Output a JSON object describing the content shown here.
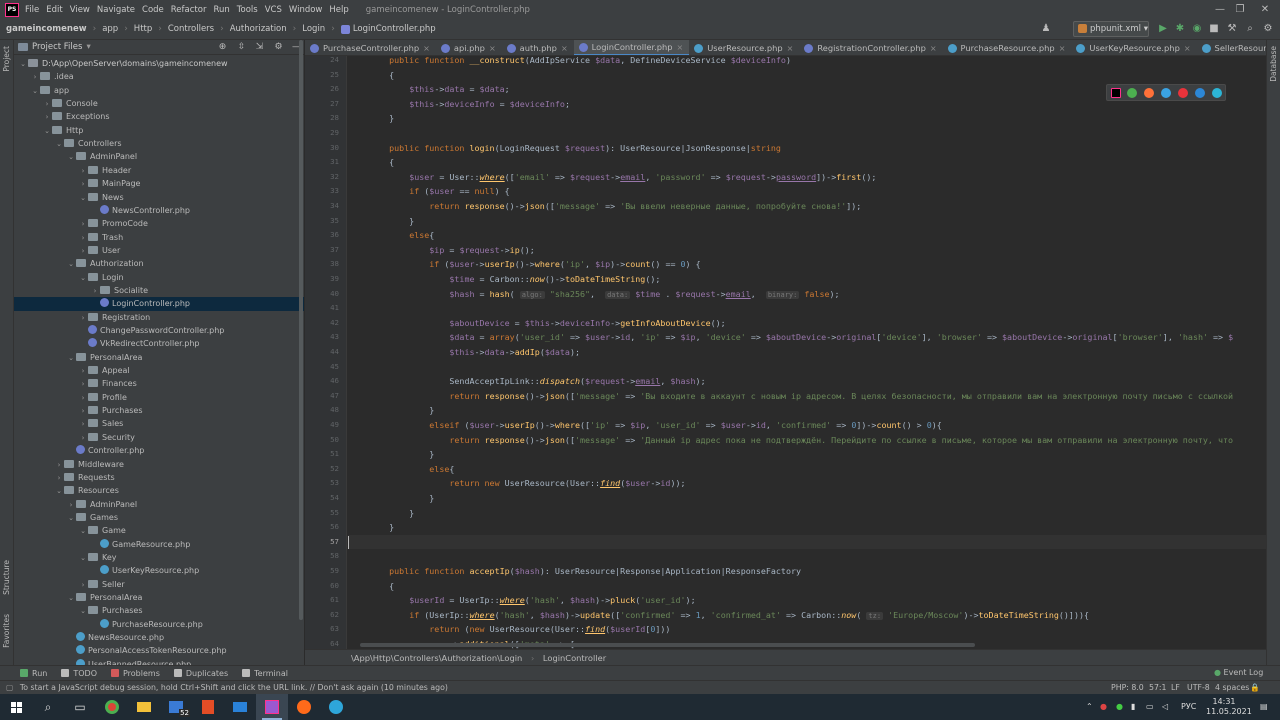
{
  "window": {
    "menu": [
      "File",
      "Edit",
      "View",
      "Navigate",
      "Code",
      "Refactor",
      "Run",
      "Tools",
      "VCS",
      "Window",
      "Help"
    ],
    "title": "gameincomenew - LoginController.php",
    "logo": "PS"
  },
  "navbar": {
    "breadcrumbs": [
      "gameincomenew",
      "app",
      "Http",
      "Controllers",
      "Authorization",
      "Login",
      "LoginController.php"
    ],
    "run_config": "phpunit.xml"
  },
  "side_strips": {
    "left_top": "Project",
    "left_mid": "Structure",
    "left_bottom": "Favorites",
    "right": "Database"
  },
  "project": {
    "title": "Project Files",
    "tree": [
      {
        "label": "D:\\App\\OpenServer\\domains\\gameincomenew",
        "depth": 0,
        "open": true,
        "type": "root"
      },
      {
        "label": ".idea",
        "depth": 1,
        "open": false,
        "type": "folder"
      },
      {
        "label": "app",
        "depth": 1,
        "open": true,
        "type": "folder"
      },
      {
        "label": "Console",
        "depth": 2,
        "open": false,
        "type": "folder"
      },
      {
        "label": "Exceptions",
        "depth": 2,
        "open": false,
        "type": "folder"
      },
      {
        "label": "Http",
        "depth": 2,
        "open": true,
        "type": "folder"
      },
      {
        "label": "Controllers",
        "depth": 3,
        "open": true,
        "type": "folder"
      },
      {
        "label": "AdminPanel",
        "depth": 4,
        "open": true,
        "type": "folder"
      },
      {
        "label": "Header",
        "depth": 5,
        "open": false,
        "type": "folder"
      },
      {
        "label": "MainPage",
        "depth": 5,
        "open": false,
        "type": "folder"
      },
      {
        "label": "News",
        "depth": 5,
        "open": true,
        "type": "folder"
      },
      {
        "label": "NewsController.php",
        "depth": 6,
        "type": "file"
      },
      {
        "label": "PromoCode",
        "depth": 5,
        "open": false,
        "type": "folder"
      },
      {
        "label": "Trash",
        "depth": 5,
        "open": false,
        "type": "folder"
      },
      {
        "label": "User",
        "depth": 5,
        "open": false,
        "type": "folder"
      },
      {
        "label": "Authorization",
        "depth": 4,
        "open": true,
        "type": "folder"
      },
      {
        "label": "Login",
        "depth": 5,
        "open": true,
        "type": "folder"
      },
      {
        "label": "Socialite",
        "depth": 6,
        "open": false,
        "type": "folder"
      },
      {
        "label": "LoginController.php",
        "depth": 6,
        "type": "file",
        "selected": true
      },
      {
        "label": "Registration",
        "depth": 5,
        "open": false,
        "type": "folder"
      },
      {
        "label": "ChangePasswordController.php",
        "depth": 5,
        "type": "file"
      },
      {
        "label": "VkRedirectController.php",
        "depth": 5,
        "type": "file"
      },
      {
        "label": "PersonalArea",
        "depth": 4,
        "open": true,
        "type": "folder"
      },
      {
        "label": "Appeal",
        "depth": 5,
        "open": false,
        "type": "folder"
      },
      {
        "label": "Finances",
        "depth": 5,
        "open": false,
        "type": "folder"
      },
      {
        "label": "Profile",
        "depth": 5,
        "open": false,
        "type": "folder"
      },
      {
        "label": "Purchases",
        "depth": 5,
        "open": false,
        "type": "folder"
      },
      {
        "label": "Sales",
        "depth": 5,
        "open": false,
        "type": "folder"
      },
      {
        "label": "Security",
        "depth": 5,
        "open": false,
        "type": "folder"
      },
      {
        "label": "Controller.php",
        "depth": 4,
        "type": "file"
      },
      {
        "label": "Middleware",
        "depth": 3,
        "open": false,
        "type": "folder"
      },
      {
        "label": "Requests",
        "depth": 3,
        "open": false,
        "type": "folder"
      },
      {
        "label": "Resources",
        "depth": 3,
        "open": true,
        "type": "folder"
      },
      {
        "label": "AdminPanel",
        "depth": 4,
        "open": false,
        "type": "folder"
      },
      {
        "label": "Games",
        "depth": 4,
        "open": true,
        "type": "folder"
      },
      {
        "label": "Game",
        "depth": 5,
        "open": true,
        "type": "folder"
      },
      {
        "label": "GameResource.php",
        "depth": 6,
        "type": "res"
      },
      {
        "label": "Key",
        "depth": 5,
        "open": true,
        "type": "folder"
      },
      {
        "label": "UserKeyResource.php",
        "depth": 6,
        "type": "res"
      },
      {
        "label": "Seller",
        "depth": 5,
        "open": false,
        "type": "folder"
      },
      {
        "label": "PersonalArea",
        "depth": 4,
        "open": true,
        "type": "folder"
      },
      {
        "label": "Purchases",
        "depth": 5,
        "open": true,
        "type": "folder"
      },
      {
        "label": "PurchaseResource.php",
        "depth": 6,
        "type": "res"
      },
      {
        "label": "NewsResource.php",
        "depth": 4,
        "type": "res"
      },
      {
        "label": "PersonalAccessTokenResource.php",
        "depth": 4,
        "type": "res"
      },
      {
        "label": "UserBannedResource.php",
        "depth": 4,
        "type": "res"
      }
    ]
  },
  "tabs": [
    {
      "label": "PurchaseController.php",
      "type": "php"
    },
    {
      "label": "api.php",
      "type": "php"
    },
    {
      "label": "auth.php",
      "type": "php"
    },
    {
      "label": "LoginController.php",
      "type": "php",
      "active": true
    },
    {
      "label": "UserResource.php",
      "type": "res"
    },
    {
      "label": "RegistrationController.php",
      "type": "php"
    },
    {
      "label": "PurchaseResource.php",
      "type": "res"
    },
    {
      "label": "UserKeyResource.php",
      "type": "res"
    },
    {
      "label": "SellerResource.php",
      "type": "res"
    }
  ],
  "editor": {
    "warning_count": "9",
    "current_line": 57,
    "lines": [
      {
        "n": 24,
        "html": "    <span class=\"kw\">public function </span><span class=\"fn\">__construct</span>(AddIpService <span class=\"vr\">$data</span>, DefineDeviceService <span class=\"vr\">$deviceInfo</span>)"
      },
      {
        "n": 25,
        "html": "    {"
      },
      {
        "n": 26,
        "html": "        <span class=\"vr\">$this</span>-><span class=\"vr\">data</span> = <span class=\"vr\">$data</span>;"
      },
      {
        "n": 27,
        "html": "        <span class=\"vr\">$this</span>-><span class=\"vr\">deviceInfo</span> = <span class=\"vr\">$deviceInfo</span>;"
      },
      {
        "n": 28,
        "html": "    }"
      },
      {
        "n": 29,
        "html": ""
      },
      {
        "n": 30,
        "html": "    <span class=\"kw\">public function </span><span class=\"fn\">login</span>(LoginRequest <span class=\"vr\">$request</span>): UserResource|JsonResponse|<span class=\"kw\">string</span>"
      },
      {
        "n": 31,
        "html": "    {"
      },
      {
        "n": 32,
        "html": "        <span class=\"vr\">$user</span> = User::<span class=\"it ul\">where</span>([<span class=\"st\">'email'</span> => <span class=\"vr\">$request</span>-><span class=\"vr ul\">email</span>, <span class=\"st\">'password'</span> => <span class=\"vr\">$request</span>-><span class=\"vr ul\">password</span>])-><span class=\"me\">first</span>();"
      },
      {
        "n": 33,
        "html": "        <span class=\"kw\">if </span>(<span class=\"vr\">$user</span> == <span class=\"kw\">null</span>) {"
      },
      {
        "n": 34,
        "html": "            <span class=\"kw\">return </span><span class=\"me\">response</span>()-><span class=\"me\">json</span>([<span class=\"st\">'message'</span> => <span class=\"st\">'Вы ввели неверные данные, попробуйте снова!'</span>]);"
      },
      {
        "n": 35,
        "html": "        }"
      },
      {
        "n": 36,
        "html": "        <span class=\"kw\">else</span>{"
      },
      {
        "n": 37,
        "html": "            <span class=\"vr\">$ip</span> = <span class=\"vr\">$request</span>-><span class=\"me\">ip</span>();"
      },
      {
        "n": 38,
        "html": "            <span class=\"kw\">if </span>(<span class=\"vr\">$user</span>-><span class=\"me\">userIp</span>()-><span class=\"me\">where</span>(<span class=\"st\">'ip'</span>, <span class=\"vr\">$ip</span>)-><span class=\"me\">count</span>() == <span class=\"nm\">0</span>) {"
      },
      {
        "n": 39,
        "html": "                <span class=\"vr\">$time</span> = Carbon::<span class=\"it\">now</span>()-><span class=\"me\">toDateTimeString</span>();"
      },
      {
        "n": 40,
        "html": "                <span class=\"vr\">$hash</span> = <span class=\"me\">hash</span>( <span class=\"hint\">algo:</span> <span class=\"st\">\"sha256\"</span>,  <span class=\"hint\">data:</span> <span class=\"vr\">$time</span> . <span class=\"vr\">$request</span>-><span class=\"vr ul\">email</span>,  <span class=\"hint\">binary:</span> <span class=\"kw\">false</span>);"
      },
      {
        "n": 41,
        "html": ""
      },
      {
        "n": 42,
        "html": "                <span class=\"vr\">$aboutDevice</span> = <span class=\"vr\">$this</span>-><span class=\"vr\">deviceInfo</span>-><span class=\"me\">getInfoAboutDevice</span>();"
      },
      {
        "n": 43,
        "html": "                <span class=\"vr\">$data</span> = <span class=\"kw\">array</span>(<span class=\"st\">'user_id'</span> => <span class=\"vr\">$user</span>-><span class=\"vr\">id</span>, <span class=\"st\">'ip'</span> => <span class=\"vr\">$ip</span>, <span class=\"st\">'device'</span> => <span class=\"vr\">$aboutDevice</span>-><span class=\"vr\">original</span>[<span class=\"st\">'device'</span>], <span class=\"st\">'browser'</span> => <span class=\"vr\">$aboutDevice</span>-><span class=\"vr\">original</span>[<span class=\"st\">'browser'</span>], <span class=\"st\">'hash'</span> => <span class=\"vr\">$</span>"
      },
      {
        "n": 44,
        "html": "                <span class=\"vr\">$this</span>-><span class=\"vr\">data</span>-><span class=\"me\">addIp</span>(<span class=\"vr\">$data</span>);"
      },
      {
        "n": 45,
        "html": ""
      },
      {
        "n": 46,
        "html": "                SendAcceptIpLink::<span class=\"it\">dispatch</span>(<span class=\"vr\">$request</span>-><span class=\"vr ul\">email</span>, <span class=\"vr\">$hash</span>);"
      },
      {
        "n": 47,
        "html": "                <span class=\"kw\">return </span><span class=\"me\">response</span>()-><span class=\"me\">json</span>([<span class=\"st\">'message'</span> => <span class=\"st\">'Вы входите в аккаунт с новым ip адресом. В целях безопасности, мы отправили вам на электронную почту письмо с ссылкой</span>"
      },
      {
        "n": 48,
        "html": "            }"
      },
      {
        "n": 49,
        "html": "            <span class=\"kw\">elseif </span>(<span class=\"vr\">$user</span>-><span class=\"me\">userIp</span>()-><span class=\"me\">where</span>([<span class=\"st\">'ip'</span> => <span class=\"vr\">$ip</span>, <span class=\"st\">'user_id'</span> => <span class=\"vr\">$user</span>-><span class=\"vr\">id</span>, <span class=\"st\">'confirmed'</span> => <span class=\"nm\">0</span>])-><span class=\"me\">count</span>() > <span class=\"nm\">0</span>){"
      },
      {
        "n": 50,
        "html": "                <span class=\"kw\">return </span><span class=\"me\">response</span>()-><span class=\"me\">json</span>([<span class=\"st\">'message'</span> => <span class=\"st\">'Данный ip адрес пока не подтверждён. Перейдите по ссылке в письме, которое мы вам отправили на электронную почту, что</span>"
      },
      {
        "n": 51,
        "html": "            }"
      },
      {
        "n": 52,
        "html": "            <span class=\"kw\">else</span>{"
      },
      {
        "n": 53,
        "html": "                <span class=\"kw\">return new </span>UserResource(User::<span class=\"it ul\">find</span>(<span class=\"vr\">$user</span>-><span class=\"vr\">id</span>));"
      },
      {
        "n": 54,
        "html": "            }"
      },
      {
        "n": 55,
        "html": "        }"
      },
      {
        "n": 56,
        "html": "    }"
      },
      {
        "n": 57,
        "html": ""
      },
      {
        "n": 58,
        "html": ""
      },
      {
        "n": 59,
        "html": "    <span class=\"kw\">public function </span><span class=\"fn\">acceptIp</span>(<span class=\"vr\">$hash</span>): UserResource|Response|Application|ResponseFactory"
      },
      {
        "n": 60,
        "html": "    {"
      },
      {
        "n": 61,
        "html": "        <span class=\"vr\">$userId</span> = UserIp::<span class=\"it ul\">where</span>(<span class=\"st\">'hash'</span>, <span class=\"vr\">$hash</span>)-><span class=\"me\">pluck</span>(<span class=\"st\">'user_id'</span>);"
      },
      {
        "n": 62,
        "html": "        <span class=\"kw\">if </span>(UserIp::<span class=\"it ul\">where</span>(<span class=\"st\">'hash'</span>, <span class=\"vr\">$hash</span>)-><span class=\"me\">update</span>([<span class=\"st\">'confirmed'</span> => <span class=\"nm\">1</span>, <span class=\"st\">'confirmed_at'</span> => Carbon::<span class=\"it\">now</span>( <span class=\"hint\">tz:</span> <span class=\"st\">'Europe/Moscow'</span>)-><span class=\"me\">toDateTimeString</span>()])){"
      },
      {
        "n": 63,
        "html": "            <span class=\"kw\">return </span>(<span class=\"kw\">new </span>UserResource(User::<span class=\"it ul\">find</span>(<span class=\"vr\">$userId</span>[<span class=\"nm\">0</span>]))"
      },
      {
        "n": 64,
        "html": "                -><span class=\"me\">additional</span>([<span class=\"st\">'meta'</span> => ["
      }
    ]
  },
  "editor_breadcrumb": [
    "\\App\\Http\\Controllers\\Authorization\\Login",
    "LoginController"
  ],
  "toolwindows": [
    {
      "label": "Run",
      "color": "#59a869"
    },
    {
      "label": "TODO",
      "color": "#bbbbbb"
    },
    {
      "label": "Problems",
      "color": "#d35a5a"
    },
    {
      "label": "Duplicates",
      "color": "#bbbbbb"
    },
    {
      "label": "Terminal",
      "color": "#bbbbbb"
    }
  ],
  "event_log": "Event Log",
  "status": {
    "message": "To start a JavaScript debug session, hold Ctrl+Shift and click the URL link. // Don't ask again (10 minutes ago)",
    "php": "PHP: 8.0",
    "position": "57:1",
    "line_sep": "LF",
    "encoding": "UTF-8",
    "indent": "4 spaces"
  },
  "taskbar": {
    "lang": "РУС",
    "time": "14:31",
    "date": "11.05.2021",
    "badge": "52"
  },
  "colors": {
    "accent": "#4a88c7",
    "selection": "#0d293e",
    "bg": "#2b2b2b"
  }
}
